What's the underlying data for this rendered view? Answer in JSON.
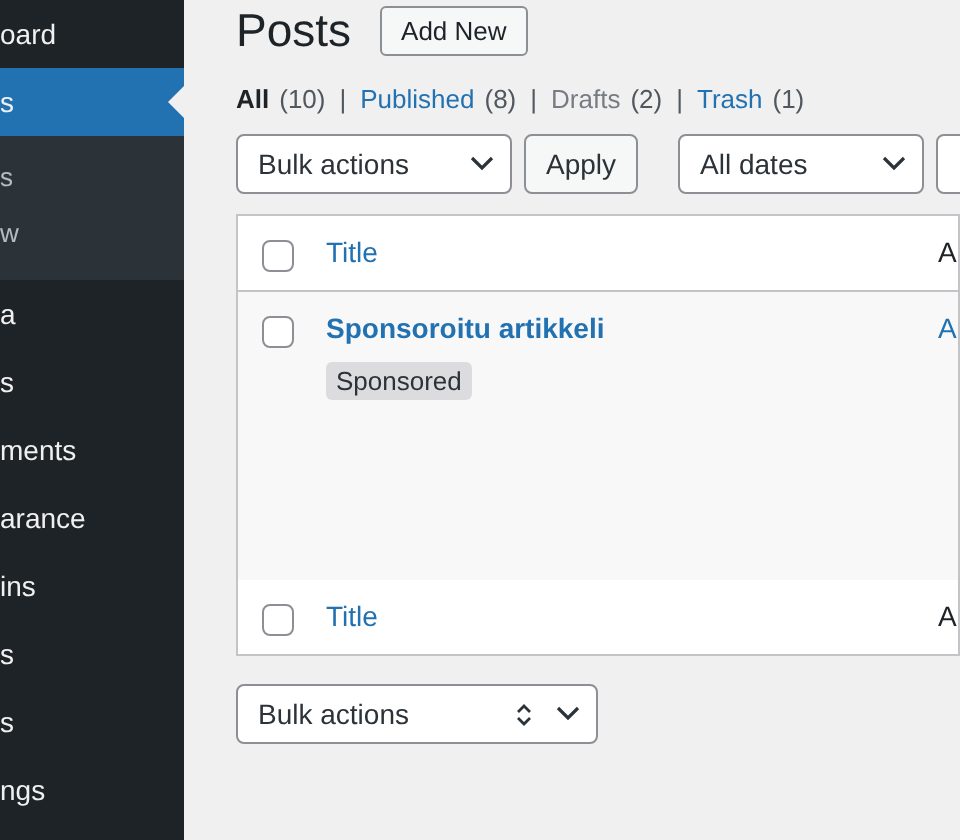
{
  "sidebar": {
    "items": [
      {
        "label": "oard",
        "selected": false
      },
      {
        "label": "s",
        "selected": true,
        "children": [
          {
            "label": "s",
            "selected": false
          },
          {
            "label": "w",
            "selected": false
          }
        ]
      },
      {
        "label": "a",
        "selected": false
      },
      {
        "label": "s",
        "selected": false
      },
      {
        "label": "ments",
        "selected": false
      },
      {
        "label": "arance",
        "selected": false
      },
      {
        "label": "ins",
        "selected": false
      },
      {
        "label": "s",
        "selected": false
      },
      {
        "label": "s",
        "selected": false
      },
      {
        "label": "ngs",
        "selected": false
      }
    ]
  },
  "page": {
    "title": "Posts",
    "add_button": "Add New"
  },
  "views": [
    {
      "label": "All",
      "count": "(10)",
      "kind": "current",
      "separator": "|"
    },
    {
      "label": "Published",
      "count": "(8)",
      "kind": "link",
      "separator": "|"
    },
    {
      "label": "Drafts",
      "count": "(2)",
      "kind": "plain",
      "separator": "|"
    },
    {
      "label": "Trash",
      "count": "(1)",
      "kind": "link"
    }
  ],
  "toolbar": {
    "bulk_actions": "Bulk actions",
    "apply": "Apply",
    "dates": "All dates"
  },
  "table": {
    "header": {
      "checked": false,
      "cells": [
        "Title",
        "A"
      ]
    },
    "rows": [
      {
        "checked": false,
        "title": "Sponsoroitu artikkeli",
        "tag": "Sponsored",
        "column_2": "A"
      }
    ],
    "footer": {
      "checked": false,
      "cells": [
        "Title",
        "A"
      ]
    }
  },
  "bottom_bulk_actions": "Bulk actions"
}
